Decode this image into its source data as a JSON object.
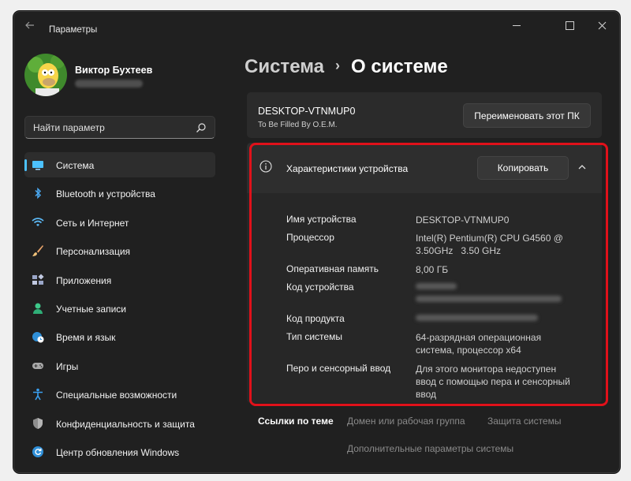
{
  "window": {
    "title": "Параметры"
  },
  "user": {
    "name": "Виктор Бухтеев"
  },
  "search": {
    "placeholder": "Найти параметр"
  },
  "sidebar": {
    "items": [
      {
        "label": "Система",
        "icon": "system-icon"
      },
      {
        "label": "Bluetooth и устройства",
        "icon": "bluetooth-icon"
      },
      {
        "label": "Сеть и Интернет",
        "icon": "wifi-icon"
      },
      {
        "label": "Персонализация",
        "icon": "brush-icon"
      },
      {
        "label": "Приложения",
        "icon": "apps-icon"
      },
      {
        "label": "Учетные записи",
        "icon": "person-icon"
      },
      {
        "label": "Время и язык",
        "icon": "globe-clock-icon"
      },
      {
        "label": "Игры",
        "icon": "gamepad-icon"
      },
      {
        "label": "Специальные возможности",
        "icon": "accessibility-icon"
      },
      {
        "label": "Конфиденциальность и защита",
        "icon": "shield-icon"
      },
      {
        "label": "Центр обновления Windows",
        "icon": "update-icon"
      }
    ]
  },
  "breadcrumb": {
    "parent": "Система",
    "separator": "›",
    "current": "О системе"
  },
  "device": {
    "name": "DESKTOP-VTNMUP0",
    "model": "To Be Filled By O.E.M.",
    "rename_label": "Переименовать этот ПК"
  },
  "specs": {
    "title": "Характеристики устройства",
    "copy_label": "Копировать",
    "rows": [
      {
        "label": "Имя устройства",
        "value": "DESKTOP-VTNMUP0"
      },
      {
        "label": "Процессор",
        "value": "Intel(R) Pentium(R) CPU G4560 @ 3.50GHz   3.50 GHz"
      },
      {
        "label": "Оперативная память",
        "value": "8,00 ГБ"
      },
      {
        "label": "Код устройства",
        "value": ""
      },
      {
        "label": "Код продукта",
        "value": ""
      },
      {
        "label": "Тип системы",
        "value": "64-разрядная операционная система, процессор x64"
      },
      {
        "label": "Перо и сенсорный ввод",
        "value": "Для этого монитора недоступен ввод с помощью пера и сенсорный ввод"
      }
    ]
  },
  "related": {
    "title": "Ссылки по теме",
    "links": [
      "Домен или рабочая группа",
      "Защита системы",
      "Дополнительные параметры системы"
    ]
  },
  "colors": {
    "accent": "#4cc2ff",
    "highlight": "#e0111a",
    "background": "#202020",
    "card": "#2b2b2b"
  }
}
